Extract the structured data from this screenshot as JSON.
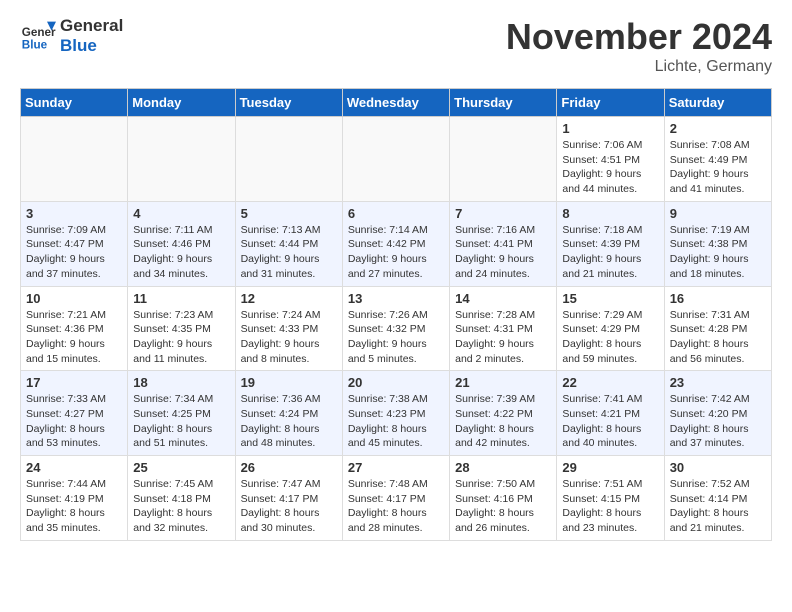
{
  "header": {
    "logo_line1": "General",
    "logo_line2": "Blue",
    "month_title": "November 2024",
    "location": "Lichte, Germany"
  },
  "weekdays": [
    "Sunday",
    "Monday",
    "Tuesday",
    "Wednesday",
    "Thursday",
    "Friday",
    "Saturday"
  ],
  "weeks": [
    [
      {
        "day": "",
        "info": ""
      },
      {
        "day": "",
        "info": ""
      },
      {
        "day": "",
        "info": ""
      },
      {
        "day": "",
        "info": ""
      },
      {
        "day": "",
        "info": ""
      },
      {
        "day": "1",
        "info": "Sunrise: 7:06 AM\nSunset: 4:51 PM\nDaylight: 9 hours and 44 minutes."
      },
      {
        "day": "2",
        "info": "Sunrise: 7:08 AM\nSunset: 4:49 PM\nDaylight: 9 hours and 41 minutes."
      }
    ],
    [
      {
        "day": "3",
        "info": "Sunrise: 7:09 AM\nSunset: 4:47 PM\nDaylight: 9 hours and 37 minutes."
      },
      {
        "day": "4",
        "info": "Sunrise: 7:11 AM\nSunset: 4:46 PM\nDaylight: 9 hours and 34 minutes."
      },
      {
        "day": "5",
        "info": "Sunrise: 7:13 AM\nSunset: 4:44 PM\nDaylight: 9 hours and 31 minutes."
      },
      {
        "day": "6",
        "info": "Sunrise: 7:14 AM\nSunset: 4:42 PM\nDaylight: 9 hours and 27 minutes."
      },
      {
        "day": "7",
        "info": "Sunrise: 7:16 AM\nSunset: 4:41 PM\nDaylight: 9 hours and 24 minutes."
      },
      {
        "day": "8",
        "info": "Sunrise: 7:18 AM\nSunset: 4:39 PM\nDaylight: 9 hours and 21 minutes."
      },
      {
        "day": "9",
        "info": "Sunrise: 7:19 AM\nSunset: 4:38 PM\nDaylight: 9 hours and 18 minutes."
      }
    ],
    [
      {
        "day": "10",
        "info": "Sunrise: 7:21 AM\nSunset: 4:36 PM\nDaylight: 9 hours and 15 minutes."
      },
      {
        "day": "11",
        "info": "Sunrise: 7:23 AM\nSunset: 4:35 PM\nDaylight: 9 hours and 11 minutes."
      },
      {
        "day": "12",
        "info": "Sunrise: 7:24 AM\nSunset: 4:33 PM\nDaylight: 9 hours and 8 minutes."
      },
      {
        "day": "13",
        "info": "Sunrise: 7:26 AM\nSunset: 4:32 PM\nDaylight: 9 hours and 5 minutes."
      },
      {
        "day": "14",
        "info": "Sunrise: 7:28 AM\nSunset: 4:31 PM\nDaylight: 9 hours and 2 minutes."
      },
      {
        "day": "15",
        "info": "Sunrise: 7:29 AM\nSunset: 4:29 PM\nDaylight: 8 hours and 59 minutes."
      },
      {
        "day": "16",
        "info": "Sunrise: 7:31 AM\nSunset: 4:28 PM\nDaylight: 8 hours and 56 minutes."
      }
    ],
    [
      {
        "day": "17",
        "info": "Sunrise: 7:33 AM\nSunset: 4:27 PM\nDaylight: 8 hours and 53 minutes."
      },
      {
        "day": "18",
        "info": "Sunrise: 7:34 AM\nSunset: 4:25 PM\nDaylight: 8 hours and 51 minutes."
      },
      {
        "day": "19",
        "info": "Sunrise: 7:36 AM\nSunset: 4:24 PM\nDaylight: 8 hours and 48 minutes."
      },
      {
        "day": "20",
        "info": "Sunrise: 7:38 AM\nSunset: 4:23 PM\nDaylight: 8 hours and 45 minutes."
      },
      {
        "day": "21",
        "info": "Sunrise: 7:39 AM\nSunset: 4:22 PM\nDaylight: 8 hours and 42 minutes."
      },
      {
        "day": "22",
        "info": "Sunrise: 7:41 AM\nSunset: 4:21 PM\nDaylight: 8 hours and 40 minutes."
      },
      {
        "day": "23",
        "info": "Sunrise: 7:42 AM\nSunset: 4:20 PM\nDaylight: 8 hours and 37 minutes."
      }
    ],
    [
      {
        "day": "24",
        "info": "Sunrise: 7:44 AM\nSunset: 4:19 PM\nDaylight: 8 hours and 35 minutes."
      },
      {
        "day": "25",
        "info": "Sunrise: 7:45 AM\nSunset: 4:18 PM\nDaylight: 8 hours and 32 minutes."
      },
      {
        "day": "26",
        "info": "Sunrise: 7:47 AM\nSunset: 4:17 PM\nDaylight: 8 hours and 30 minutes."
      },
      {
        "day": "27",
        "info": "Sunrise: 7:48 AM\nSunset: 4:17 PM\nDaylight: 8 hours and 28 minutes."
      },
      {
        "day": "28",
        "info": "Sunrise: 7:50 AM\nSunset: 4:16 PM\nDaylight: 8 hours and 26 minutes."
      },
      {
        "day": "29",
        "info": "Sunrise: 7:51 AM\nSunset: 4:15 PM\nDaylight: 8 hours and 23 minutes."
      },
      {
        "day": "30",
        "info": "Sunrise: 7:52 AM\nSunset: 4:14 PM\nDaylight: 8 hours and 21 minutes."
      }
    ]
  ]
}
